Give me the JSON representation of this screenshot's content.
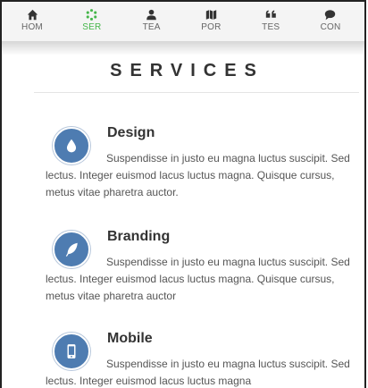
{
  "nav": {
    "items": [
      {
        "label": "HOM",
        "icon": "home-icon"
      },
      {
        "label": "SER",
        "icon": "services-icon"
      },
      {
        "label": "TEA",
        "icon": "team-icon"
      },
      {
        "label": "POR",
        "icon": "portfolio-icon"
      },
      {
        "label": "TES",
        "icon": "testimonials-icon"
      },
      {
        "label": "CON",
        "icon": "contact-icon"
      }
    ],
    "active_index": 1,
    "active_color": "#45b64a"
  },
  "section": {
    "title": "SERVICES"
  },
  "services": [
    {
      "title": "Design",
      "icon": "water-drop-icon",
      "description": "Suspendisse in justo eu magna luctus suscipit. Sed lectus. Integer euismod lacus luctus magna. Quisque cursus, metus vitae pharetra auctor."
    },
    {
      "title": "Branding",
      "icon": "feather-icon",
      "description": "Suspendisse in justo eu magna luctus suscipit. Sed lectus. Integer euismod lacus luctus magna. Quisque cursus, metus vitae pharetra auctor"
    },
    {
      "title": "Mobile",
      "icon": "mobile-icon",
      "description": "Suspendisse in justo eu magna luctus suscipit. Sed lectus. Integer euismod lacus luctus magna"
    }
  ],
  "colors": {
    "icon_circle": "#4e7cb1",
    "heading": "#333333",
    "body_text": "#555555"
  }
}
